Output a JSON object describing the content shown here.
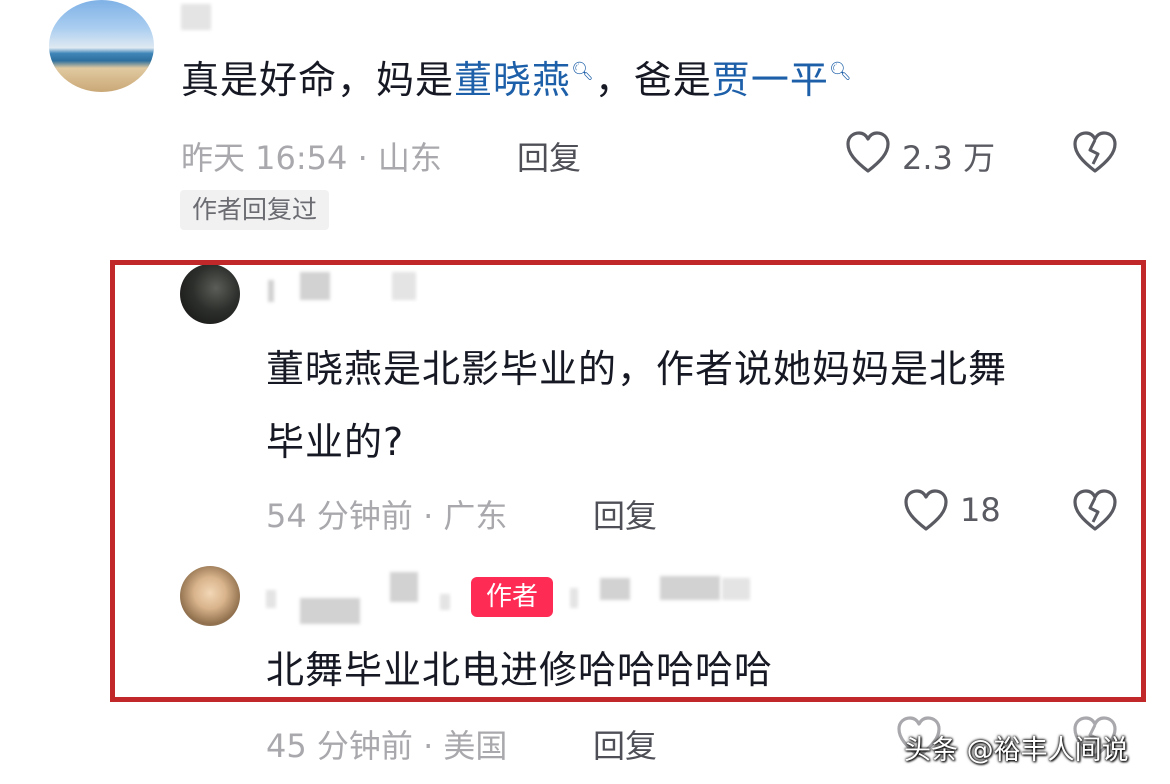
{
  "comments": [
    {
      "text_prefix": "真是好命，妈是",
      "link1": "董晓燕",
      "text_mid": "，爸是",
      "link2": "贾一平",
      "time_location": "昨天 16:54 · 山东",
      "reply_label": "回复",
      "likes": "2.3 万",
      "badge": "作者回复过"
    },
    {
      "line1": "董晓燕是北影毕业的，作者说她妈妈是北舞",
      "line2": "毕业的?",
      "time_location": "54 分钟前 · 广东",
      "reply_label": "回复",
      "likes": "18"
    },
    {
      "author_tag": "作者",
      "text": "北舞毕业北电进修哈哈哈哈哈",
      "time_location": "45 分钟前 · 美国",
      "reply_label": "回复"
    }
  ],
  "icons": {
    "search": "search-icon",
    "like": "heart-icon",
    "dislike": "broken-heart-icon"
  },
  "colors": {
    "link": "#1d5fa8",
    "highlight": "#c0282a",
    "author_tag": "#fe2c55"
  },
  "watermark": "头条 @裕丰人间说"
}
